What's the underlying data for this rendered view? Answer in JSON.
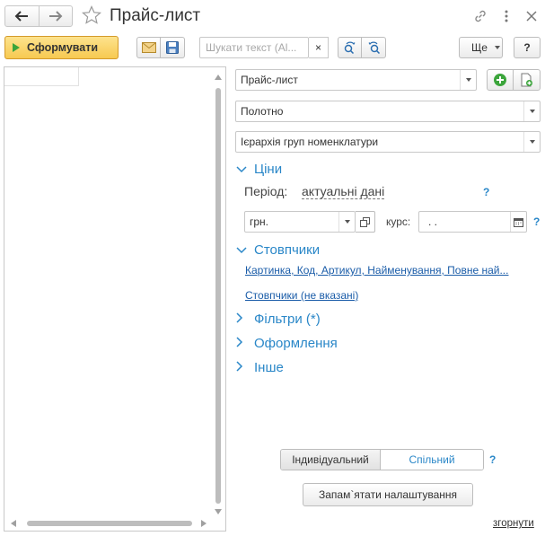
{
  "window": {
    "title": "Прайс-лист"
  },
  "toolbar": {
    "generate_label": "Сформувати",
    "search_placeholder": "Шукати текст (Al...",
    "search_clear": "×",
    "more_label": "Ще",
    "help_label": "?"
  },
  "settings": {
    "report_variant": "Прайс-лист",
    "format": "Полотно",
    "grouping": "Ієрархія груп номенклатури",
    "prices": {
      "section_label": "Ціни",
      "period_label": "Період:",
      "period_value": "актуальні дані",
      "help": "?",
      "currency": "грн.",
      "rate_label": "курс:",
      "rate_value": ". .",
      "rate_help": "?"
    },
    "columns": {
      "section_label": "Стовпчики",
      "selected_link": "Картинка, Код, Артикул, Найменування, Повне най...",
      "unset_link": "Стовпчики (не вказані)"
    },
    "filters_label": "Фільтри (*)",
    "design_label": "Оформлення",
    "other_label": "Інше"
  },
  "mode": {
    "individual_label": "Індивідуальний",
    "shared_label": "Спільний",
    "help": "?"
  },
  "footer": {
    "save_settings_label": "Запам`ятати налаштування",
    "collapse_label": "згорнути"
  },
  "colors": {
    "accent": "#2a87c8",
    "primary_button": "#f7c951",
    "run_icon": "#3ba53b",
    "add_icon": "#3ba53b"
  }
}
